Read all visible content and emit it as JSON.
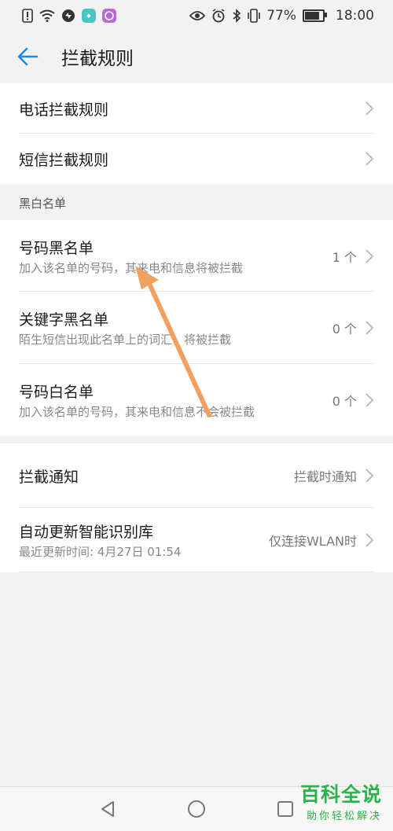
{
  "status_bar": {
    "battery_percent": "77%",
    "time": "18:00"
  },
  "header": {
    "title": "拦截规则"
  },
  "rules": [
    {
      "label": "电话拦截规则"
    },
    {
      "label": "短信拦截规则"
    }
  ],
  "blackwhite_section": {
    "header": "黑白名单",
    "items": [
      {
        "title": "号码黑名单",
        "subtitle": "加入该名单的号码，其来电和信息将被拦截",
        "value": "1 个"
      },
      {
        "title": "关键字黑名单",
        "subtitle": "陌生短信出现此名单上的词汇，将被拦截",
        "value": "0 个"
      },
      {
        "title": "号码白名单",
        "subtitle": "加入该名单的号码，其来电和信息不会被拦截",
        "value": "0 个"
      }
    ]
  },
  "settings": [
    {
      "title": "拦截通知",
      "value": "拦截时通知"
    },
    {
      "title": "自动更新智能识别库",
      "subtitle": "最近更新时间: 4月27日 01:54",
      "value": "仅连接WLAN时"
    }
  ],
  "watermark": {
    "big": "百科全说",
    "small": "助你轻松解决"
  },
  "colors": {
    "accent": "#1e88e5",
    "arrow": "#f0a060",
    "watermark": "#2db34a"
  },
  "icons": [
    "back-arrow-icon",
    "chevron-right-icon",
    "nav-back-icon",
    "nav-home-icon",
    "nav-recents-icon"
  ]
}
